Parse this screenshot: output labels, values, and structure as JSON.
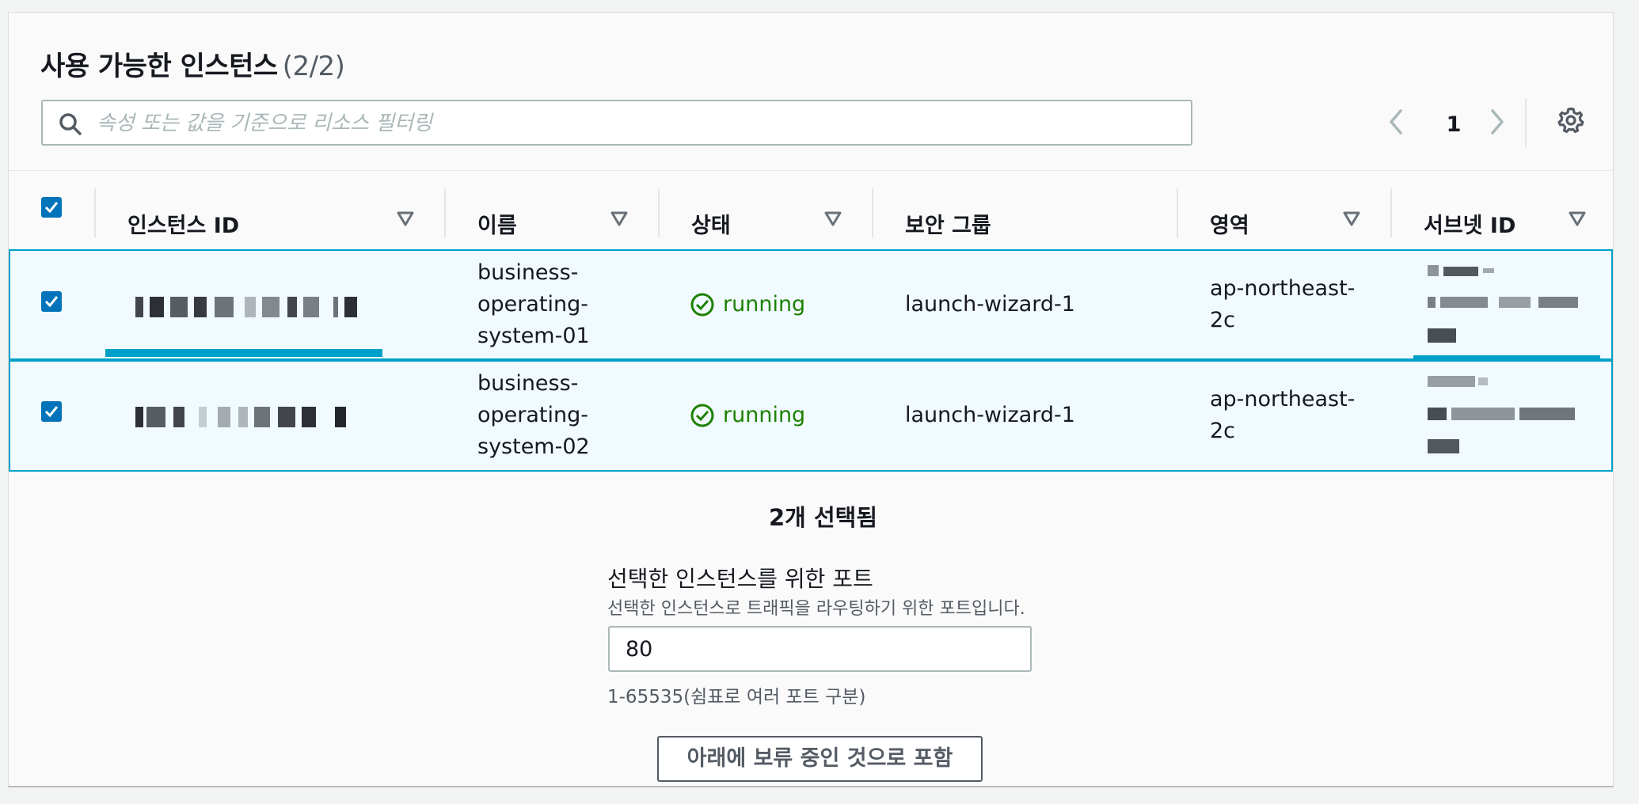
{
  "panel": {
    "title": "사용 가능한 인스턴스",
    "count": "(2/2)"
  },
  "search": {
    "placeholder": "속성 또는 값을 기준으로 리소스 필터링",
    "icon": "search-icon"
  },
  "pagination": {
    "current_page": "1",
    "prev_icon": "chevron-left-icon",
    "next_icon": "chevron-right-icon"
  },
  "settings_icon": "gear-icon",
  "table": {
    "columns": [
      "인스턴스 ID",
      "이름",
      "상태",
      "보안 그룹",
      "영역",
      "서브넷 ID"
    ],
    "rows": [
      {
        "selected": true,
        "instance_id": "(redacted)",
        "name": "business-operating-system-01",
        "name_lines": [
          "business-",
          "operating-",
          "system-01"
        ],
        "state": "running",
        "security_group": "launch-wizard-1",
        "zone_lines": [
          "ap-northeast-",
          "2c"
        ],
        "subnet_id": "(redacted)"
      },
      {
        "selected": true,
        "instance_id": "(redacted)",
        "name": "business-operating-system-02",
        "name_lines": [
          "business-",
          "operating-",
          "system-02"
        ],
        "state": "running",
        "security_group": "launch-wizard-1",
        "zone_lines": [
          "ap-northeast-",
          "2c"
        ],
        "subnet_id": "(redacted)"
      }
    ]
  },
  "selection": {
    "summary": "2개 선택됨"
  },
  "port": {
    "label": "선택한 인스턴스를 위한 포트",
    "description": "선택한 인스턴스로 트래픽을 라우팅하기 위한 포트입니다.",
    "value": "80",
    "hint": "1-65535(쉼표로 여러 포트 구분)"
  },
  "include_button": "아래에 보류 중인 것으로 포함",
  "colors": {
    "accent": "#0073bb",
    "selected_row_border": "#00a1c9",
    "selected_row_bg": "#f1faff",
    "running": "#1d8102"
  }
}
